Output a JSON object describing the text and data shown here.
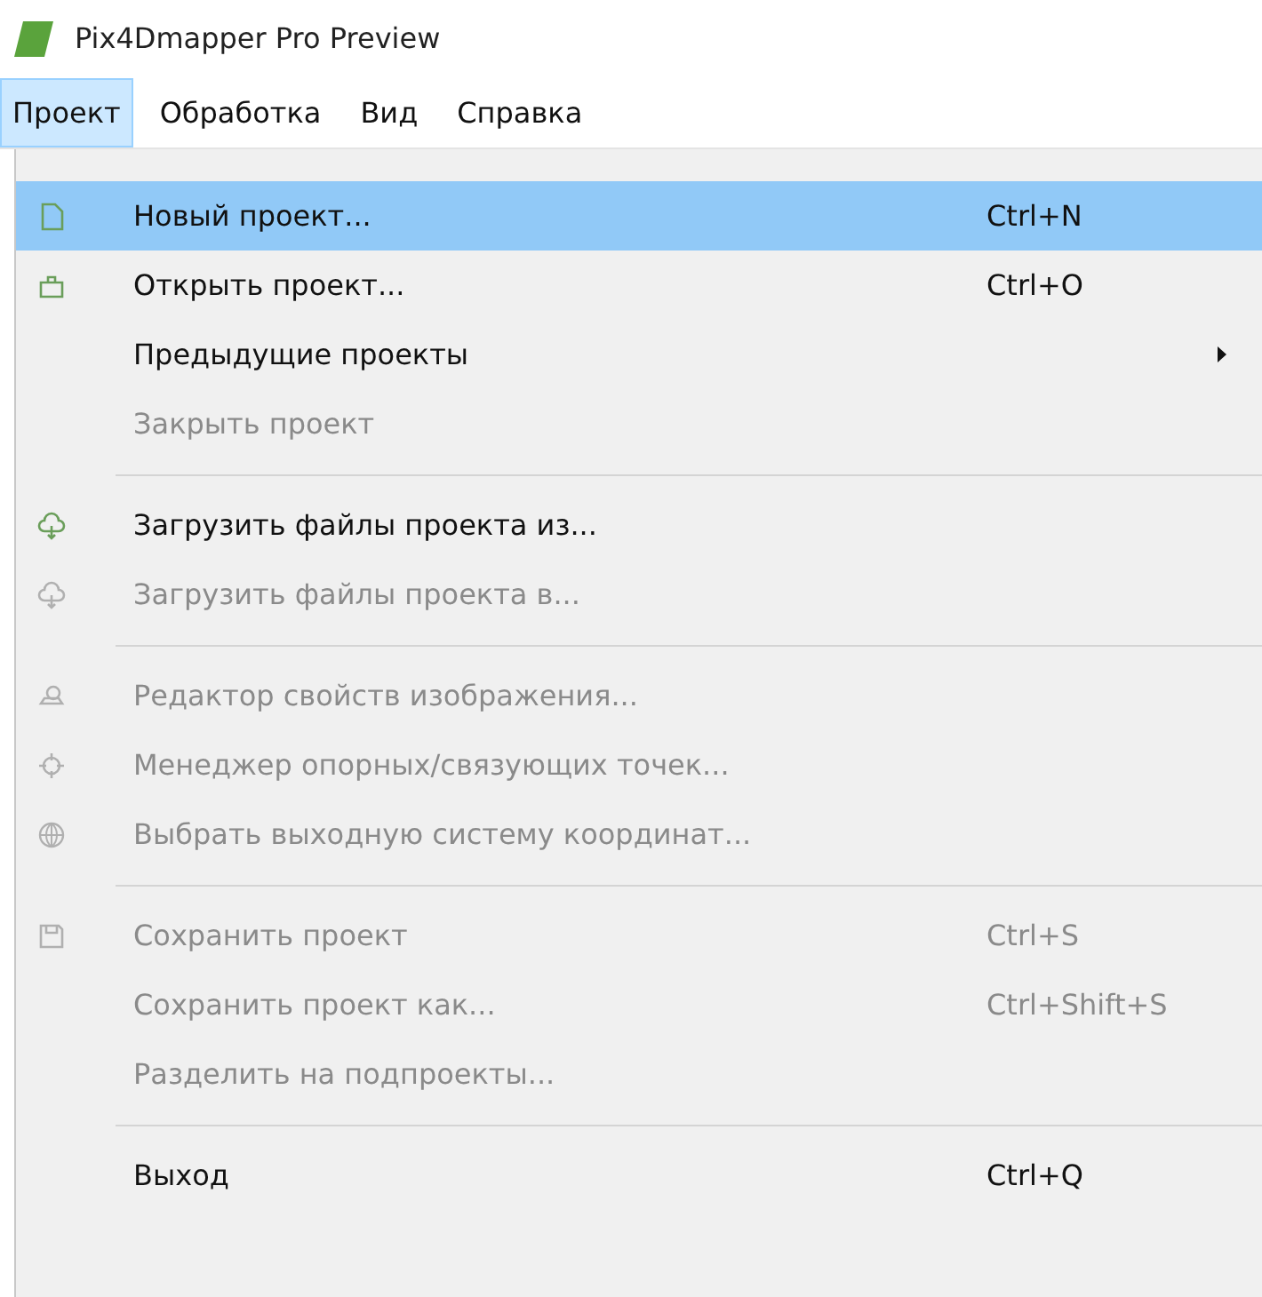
{
  "window": {
    "title": "Pix4Dmapper Pro Preview"
  },
  "menubar": [
    {
      "label": "Проект",
      "selected": true
    },
    {
      "label": "Обработка",
      "selected": false
    },
    {
      "label": "Вид",
      "selected": false
    },
    {
      "label": "Справка",
      "selected": false
    }
  ],
  "menu": [
    {
      "kind": "item",
      "label": "Новый проект...",
      "shortcut": "Ctrl+N",
      "disabled": false,
      "selected": true
    },
    {
      "kind": "item",
      "label": "Открыть проект...",
      "shortcut": "Ctrl+O",
      "disabled": false,
      "selected": false
    },
    {
      "kind": "item",
      "label": "Предыдущие проекты",
      "submenu": true,
      "disabled": false,
      "selected": false
    },
    {
      "kind": "item",
      "label": "Закрыть проект",
      "disabled": true,
      "selected": false
    },
    {
      "kind": "separator"
    },
    {
      "kind": "item",
      "label": "Загрузить файлы проекта из...",
      "disabled": false,
      "selected": false
    },
    {
      "kind": "item",
      "label": "Загрузить файлы проекта в...",
      "disabled": true,
      "selected": false
    },
    {
      "kind": "separator"
    },
    {
      "kind": "item",
      "label": "Редактор свойств изображения...",
      "disabled": true,
      "selected": false
    },
    {
      "kind": "item",
      "label": "Менеджер опорных/связующих точек...",
      "disabled": true,
      "selected": false
    },
    {
      "kind": "item",
      "label": "Выбрать выходную систему координат...",
      "disabled": true,
      "selected": false
    },
    {
      "kind": "separator"
    },
    {
      "kind": "item",
      "label": "Сохранить проект",
      "shortcut": "Ctrl+S",
      "disabled": true,
      "selected": false
    },
    {
      "kind": "item",
      "label": "Сохранить проект как...",
      "shortcut": "Ctrl+Shift+S",
      "disabled": true,
      "selected": false
    },
    {
      "kind": "item",
      "label": "Разделить на подпроекты...",
      "disabled": true,
      "selected": false
    },
    {
      "kind": "separator"
    },
    {
      "kind": "item",
      "label": "Выход",
      "shortcut": "Ctrl+Q",
      "disabled": false,
      "selected": false
    }
  ]
}
